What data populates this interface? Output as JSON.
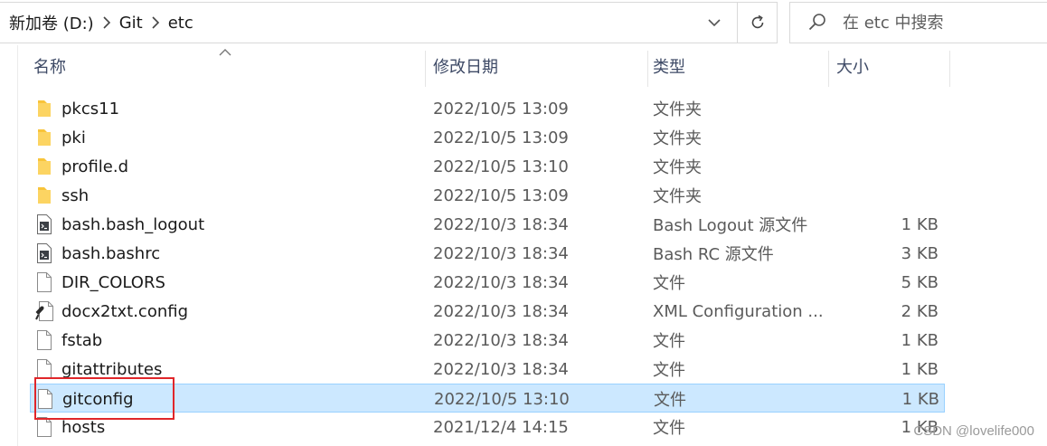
{
  "address_bar": {
    "crumbs": [
      "新加卷 (D:)",
      "Git",
      "etc"
    ]
  },
  "search": {
    "placeholder": "在 etc 中搜索"
  },
  "columns": {
    "name": "名称",
    "date": "修改日期",
    "type": "类型",
    "size": "大小"
  },
  "files": [
    {
      "name": "pkcs11",
      "date": "2022/10/5 13:09",
      "type": "文件夹",
      "size": "",
      "icon": "folder-icon"
    },
    {
      "name": "pki",
      "date": "2022/10/5 13:09",
      "type": "文件夹",
      "size": "",
      "icon": "folder-icon"
    },
    {
      "name": "profile.d",
      "date": "2022/10/5 13:10",
      "type": "文件夹",
      "size": "",
      "icon": "folder-icon"
    },
    {
      "name": "ssh",
      "date": "2022/10/5 13:09",
      "type": "文件夹",
      "size": "",
      "icon": "folder-icon"
    },
    {
      "name": "bash.bash_logout",
      "date": "2022/10/3 18:34",
      "type": "Bash Logout 源文件",
      "size": "1 KB",
      "icon": "script-file-icon"
    },
    {
      "name": "bash.bashrc",
      "date": "2022/10/3 18:34",
      "type": "Bash RC 源文件",
      "size": "3 KB",
      "icon": "script-file-icon"
    },
    {
      "name": "DIR_COLORS",
      "date": "2022/10/3 18:34",
      "type": "文件",
      "size": "5 KB",
      "icon": "file-icon"
    },
    {
      "name": "docx2txt.config",
      "date": "2022/10/3 18:34",
      "type": "XML Configuration ...",
      "size": "2 KB",
      "icon": "config-file-icon"
    },
    {
      "name": "fstab",
      "date": "2022/10/3 18:34",
      "type": "文件",
      "size": "1 KB",
      "icon": "file-icon"
    },
    {
      "name": "gitattributes",
      "date": "2022/10/3 18:34",
      "type": "文件",
      "size": "1 KB",
      "icon": "file-icon"
    },
    {
      "name": "gitconfig",
      "date": "2022/10/5 13:10",
      "type": "文件",
      "size": "1 KB",
      "icon": "file-icon",
      "selected": true
    },
    {
      "name": "hosts",
      "date": "2021/12/4 14:15",
      "type": "文件",
      "size": "1 KB",
      "icon": "file-icon"
    }
  ],
  "watermark": "CSDN @lovelife000",
  "colors": {
    "selection_bg": "#cce8ff",
    "selection_border": "#99d1ff",
    "folder": "#f8c43a",
    "highlight_box": "#e0262a"
  }
}
